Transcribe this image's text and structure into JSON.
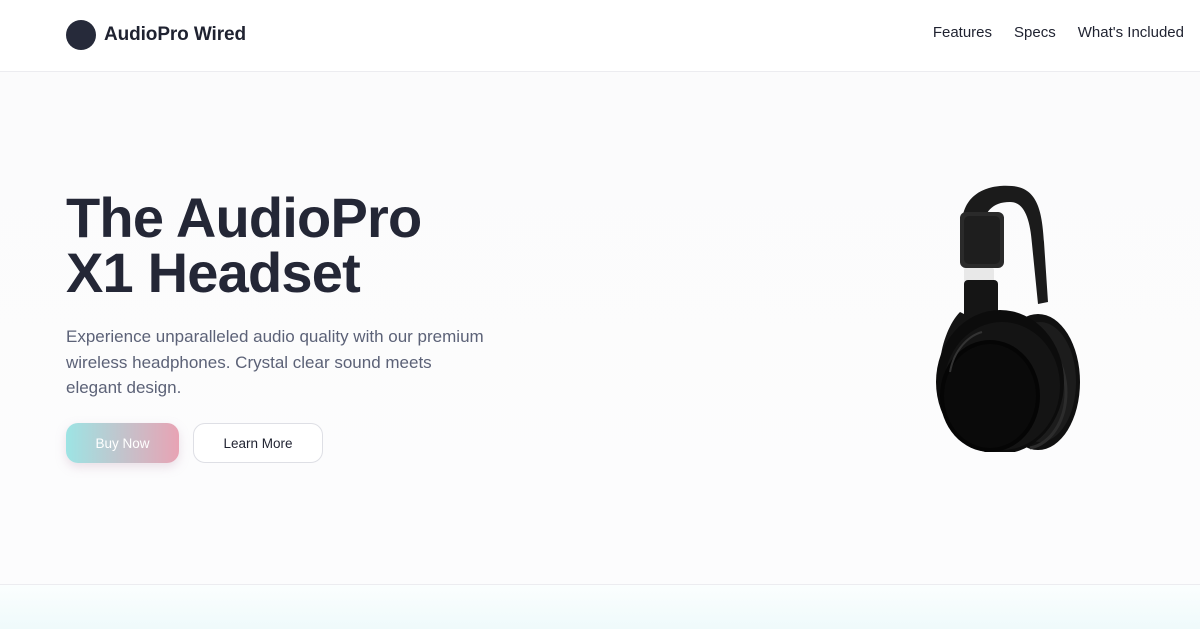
{
  "header": {
    "brand_name": "AudioPro Wired",
    "logo_icon": "brand-logo-circle",
    "nav": [
      {
        "label": "Features"
      },
      {
        "label": "Specs"
      },
      {
        "label": "What's Included"
      }
    ]
  },
  "hero": {
    "title_line1": "The AudioPro",
    "title_line2": "X1 Headset",
    "description": "Experience unparalleled audio quality with our premium wireless headphones. Crystal clear sound meets elegant design.",
    "buy_label": "Buy Now",
    "learn_label": "Learn More",
    "image_icon": "headphones-image"
  },
  "colors": {
    "text_dark": "#242736",
    "text_muted": "#5c6277",
    "accent_start": "#9de4e4",
    "accent_end": "#e8a3b4",
    "logo": "#262a3a"
  }
}
